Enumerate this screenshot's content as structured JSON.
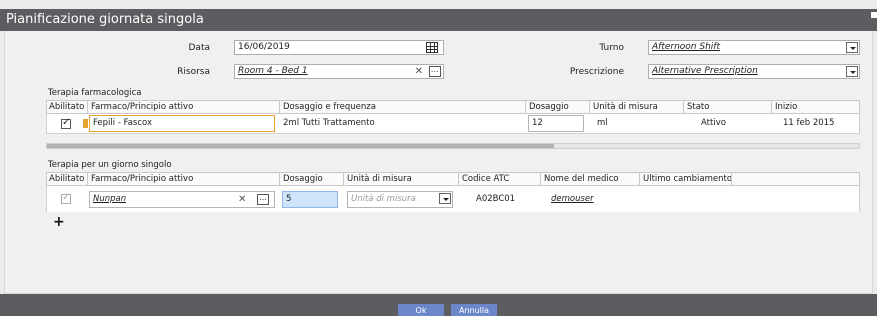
{
  "window": {
    "title": "Pianificazione giornata singola"
  },
  "header_fields": {
    "data_label": "Data",
    "data_value": "16/06/2019",
    "risorsa_label": "Risorsa",
    "risorsa_value": "Room 4 - Bed 1",
    "turno_label": "Turno",
    "turno_value": "Afternoon Shift",
    "prescrizione_label": "Prescrizione",
    "prescrizione_value": "Alternative Prescription"
  },
  "terapia_farmacologica": {
    "title": "Terapia farmacologica",
    "columns": [
      "Abilitato",
      "Farmaco/Principio attivo",
      "Dosaggio e frequenza",
      "Dosaggio",
      "Unità di misura",
      "Stato",
      "Inizio"
    ],
    "rows": [
      {
        "abilitato": true,
        "farmaco": "Fepili - Fascox",
        "dosaggio_frequenza": "2ml Tutti Trattamento",
        "dosaggio": "12",
        "unita": "ml",
        "stato": "Attivo",
        "inizio": "11 feb 2015"
      }
    ]
  },
  "terapia_singolo": {
    "title": "Terapia per un giorno singolo",
    "columns": [
      "Abilitato",
      "Farmaco/Principio attivo",
      "Dosaggio",
      "Unità di misura",
      "Codice ATC",
      "Nome del medico",
      "Ultimo cambiamento"
    ],
    "rows": [
      {
        "abilitato": true,
        "farmaco": "Nunpan",
        "dosaggio": "5",
        "unita_placeholder": "Unità di misura",
        "codice_atc": "A02BC01",
        "medico": "demouser",
        "ultimo": ""
      }
    ]
  },
  "add_label": "+",
  "footer": {
    "ok_label": "Ok",
    "annulla_label": "Annulla"
  },
  "colors": {
    "titlebar": "#5d5d61",
    "button": "#6c87c9",
    "warning": "#e5a22c",
    "focus": "#e8a330"
  }
}
